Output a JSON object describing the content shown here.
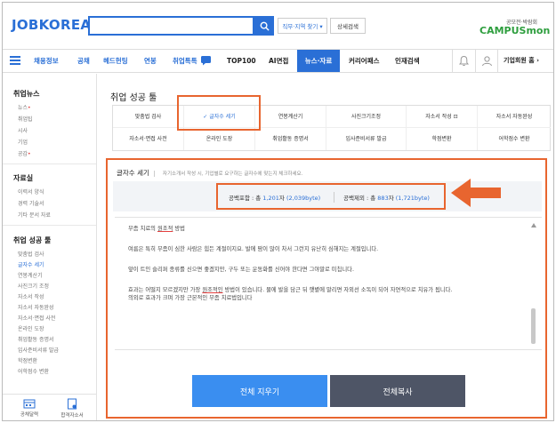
{
  "header": {
    "logo": "JOBKOREA",
    "filter_label": "직무·지역 찾기 ▾",
    "detail_search": "상세검색",
    "campus_sub": "공모전·박람회",
    "campus_brand": "CAMPUSmon"
  },
  "nav": {
    "items": [
      "채용정보",
      "공채",
      "헤드헌팅",
      "연봉",
      "취업톡톡",
      "TOP100",
      "AI면접",
      "뉴스·자료",
      "커리어패스",
      "인재검색"
    ],
    "member": "기업회원 홈 ›"
  },
  "sidebar": {
    "news_title": "취업뉴스",
    "news_items": [
      "뉴스",
      "취업팁",
      "시사",
      "기업",
      "공감"
    ],
    "resources_title": "자료실",
    "resource_items": [
      "이력서 양식",
      "경력 기술서",
      "기타 문서 자료"
    ],
    "tools_title": "취업 성공 툴",
    "tool_items": [
      "맞춤법 검사",
      "글자수 세기",
      "연봉계산기",
      "사진크기 조정",
      "자소서 작성",
      "자소서 자동완성",
      "자소서·면접 사전",
      "온라인 도장",
      "취업활동 증명서",
      "입사준비서류 발급",
      "학점변환",
      "어학점수 변환"
    ],
    "bottom_tools": [
      "공채달력",
      "합격자소서"
    ]
  },
  "main": {
    "title": "취업 성공 툴",
    "tools_row1": [
      "맞춤법 검사",
      "✓ 글자수 세기",
      "연봉계산기",
      "사진크기조정",
      "자소서 작성 ⊡",
      "자소서 자동완성"
    ],
    "tools_row2": [
      "자소서·면접 사전",
      "온라인 도장",
      "취업활동 증명서",
      "입사준비서류 발급",
      "학점변환",
      "어학점수 변환"
    ],
    "panel_title": "글자수 세기",
    "panel_desc": "자기소개서 작성 시, 기업별로 요구하는 글자수에 맞는지 체크하세요.",
    "stat_with_space_label": "공백포함 : 총 ",
    "stat_with_space_chars": "1,201",
    "stat_with_space_unit": "자 ",
    "stat_with_space_bytes": "(2,039byte)",
    "stat_without_space_label": "공백제외 : 총 ",
    "stat_without_space_chars": "883",
    "stat_without_space_unit": "자 ",
    "stat_without_space_bytes": "(1,721byte)",
    "editor": {
      "p1_a": "무좀 치료의 ",
      "p1_kw": "원조적",
      "p1_b": " 방법",
      "p2": "여름은 특히 무좀이 심한 사람은 힘든 계절이지요. 발에 땀이 많이 차서 그런지 유난히 심해지는 계절입니다.",
      "p3": "앞이 트인 슬리퍼 종류를 신으면 좋겠지만, 구두 또는 운동화를 신어야 한다면 그야말로 미칩니다.",
      "p4_a": "효과는 어떨지 모르겠지만 가장 ",
      "p4_kw": "원조적인",
      "p4_b": " 방법이 있습니다. 물에 발을 담근 뒤 햇볕에 말리면 자외선 소독이 되어 자연적으로 치유가 됩니다.",
      "p5": "의외로 효과가 크며 가장 근본적인 무좀 치료법입니다"
    },
    "clear_button": "전체 지우기",
    "copy_button": "전체복사"
  },
  "colors": {
    "brand_blue": "#2a6fd6",
    "highlight_orange": "#e8652f",
    "clear_button": "#3a8ef0",
    "copy_button": "#4e5566"
  }
}
